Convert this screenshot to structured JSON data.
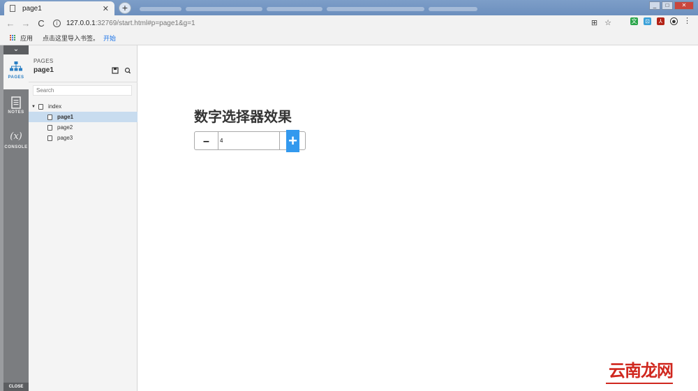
{
  "browser": {
    "tab_title": "page1",
    "tab_close": "✕",
    "new_tab": "+",
    "back": "←",
    "forward": "→",
    "reload": "C",
    "url_host": "127.0.0.1",
    "url_rest": ":32769/start.html#p=page1&g=1",
    "bookmarks": {
      "apps_label": "应用",
      "import_text": "点击这里导入书签。",
      "start_link": "开始"
    }
  },
  "rail": {
    "toggle": "⌄",
    "items": [
      {
        "label": "PAGES",
        "icon": "sitemap-icon"
      },
      {
        "label": "NOTES",
        "icon": "notes-icon"
      },
      {
        "label": "CONSOLE",
        "icon": "variable-icon",
        "glyph": "(x)"
      }
    ],
    "close_label": "CLOSE"
  },
  "panel": {
    "category": "PAGES",
    "title": "page1",
    "search_placeholder": "Search",
    "tree": {
      "root": "index",
      "children": [
        "page1",
        "page2",
        "page3"
      ],
      "selected": "page1"
    }
  },
  "canvas": {
    "heading": "数字选择器效果",
    "stepper": {
      "minus_label": "–",
      "value": "4",
      "plus_label": "+"
    }
  },
  "colors": {
    "accent": "#3399ee",
    "selected_row": "#c8dcef",
    "watermark": "#d0281f"
  },
  "watermark": "云南龙网"
}
